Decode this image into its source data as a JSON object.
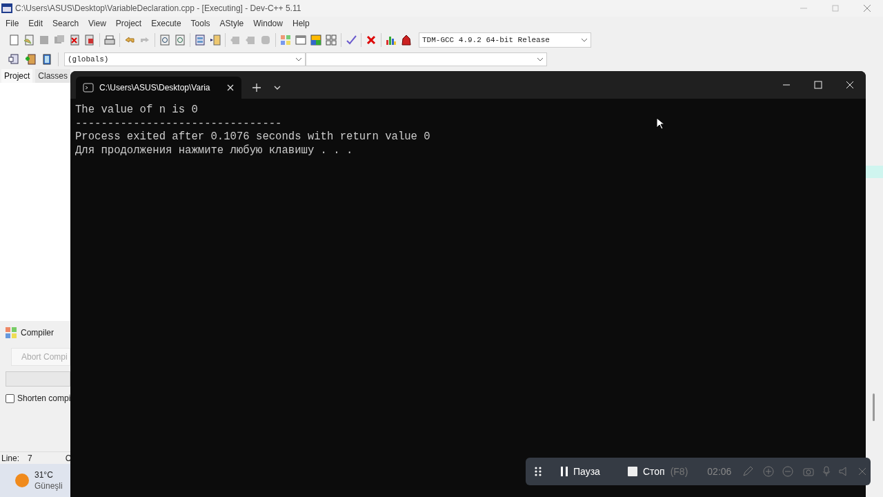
{
  "window": {
    "title": "C:\\Users\\ASUS\\Desktop\\VariableDeclaration.cpp - [Executing] - Dev-C++ 5.11"
  },
  "menu": [
    "File",
    "Edit",
    "Search",
    "View",
    "Project",
    "Execute",
    "Tools",
    "AStyle",
    "Window",
    "Help"
  ],
  "compiler_select": {
    "value": "TDM-GCC 4.9.2 64-bit Release"
  },
  "scope_select": {
    "value": "(globals)"
  },
  "left_tabs": [
    {
      "label": "Project",
      "selected": true
    },
    {
      "label": "Classes",
      "selected": false
    }
  ],
  "bottom_panel": {
    "tab": "Compiler",
    "progress": {
      "level": 0
    },
    "abort_button": {
      "label": "Abort Compi",
      "disabled": true
    },
    "shorten_checkbox": {
      "label": "Shorten compi",
      "checked": false
    }
  },
  "status_bar": {
    "line_label": "Line:",
    "line_value": "7",
    "column_3": "C"
  },
  "taskbar": {
    "temperature": "31°C",
    "weather": "Güneşli"
  },
  "console": {
    "tab_title": "C:\\Users\\ASUS\\Desktop\\Varia",
    "lines": [
      "The value of n is 0",
      "--------------------------------",
      "Process exited after 0.1076 seconds with return value 0",
      "Для продолжения нажмите любую клавишу . . ."
    ]
  },
  "recorder": {
    "pause": "Пауза",
    "stop": "Стоп",
    "stop_key": "(F8)",
    "time": "02:06"
  }
}
